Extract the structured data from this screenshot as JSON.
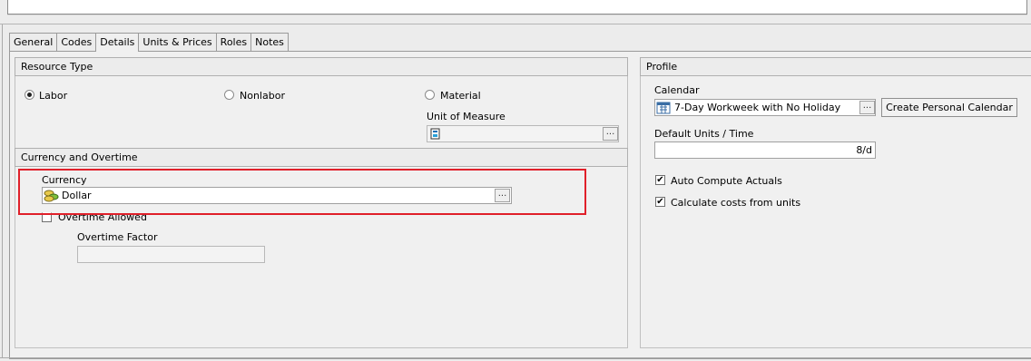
{
  "tabs": [
    "General",
    "Codes",
    "Details",
    "Units & Prices",
    "Roles",
    "Notes"
  ],
  "active_tab": "Details",
  "resource_type": {
    "title": "Resource Type",
    "options": [
      "Labor",
      "Nonlabor",
      "Material"
    ],
    "selected": "Labor",
    "unit_of_measure_label": "Unit of Measure",
    "unit_of_measure_value": ""
  },
  "currency_overtime": {
    "title": "Currency and Overtime",
    "currency_label": "Currency",
    "currency_value": "Dollar",
    "overtime_allowed_label": "Overtime Allowed",
    "overtime_allowed": false,
    "overtime_factor_label": "Overtime Factor",
    "overtime_factor_value": ""
  },
  "profile": {
    "title": "Profile",
    "calendar_label": "Calendar",
    "calendar_value": "7-Day Workweek with No Holiday",
    "create_calendar_button": "Create Personal Calendar",
    "default_units_label": "Default Units / Time",
    "default_units_value": "8/d",
    "auto_compute_label": "Auto Compute Actuals",
    "auto_compute": true,
    "calc_costs_label": "Calculate costs from units",
    "calc_costs": true
  },
  "ellipsis": "...",
  "checkmark": "✔",
  "colors": {
    "highlight": "#e0202a",
    "panel_bg": "#f0f0f0"
  },
  "icons": [
    "unit-of-measure-icon",
    "currency-coins-icon",
    "calendar-icon"
  ]
}
